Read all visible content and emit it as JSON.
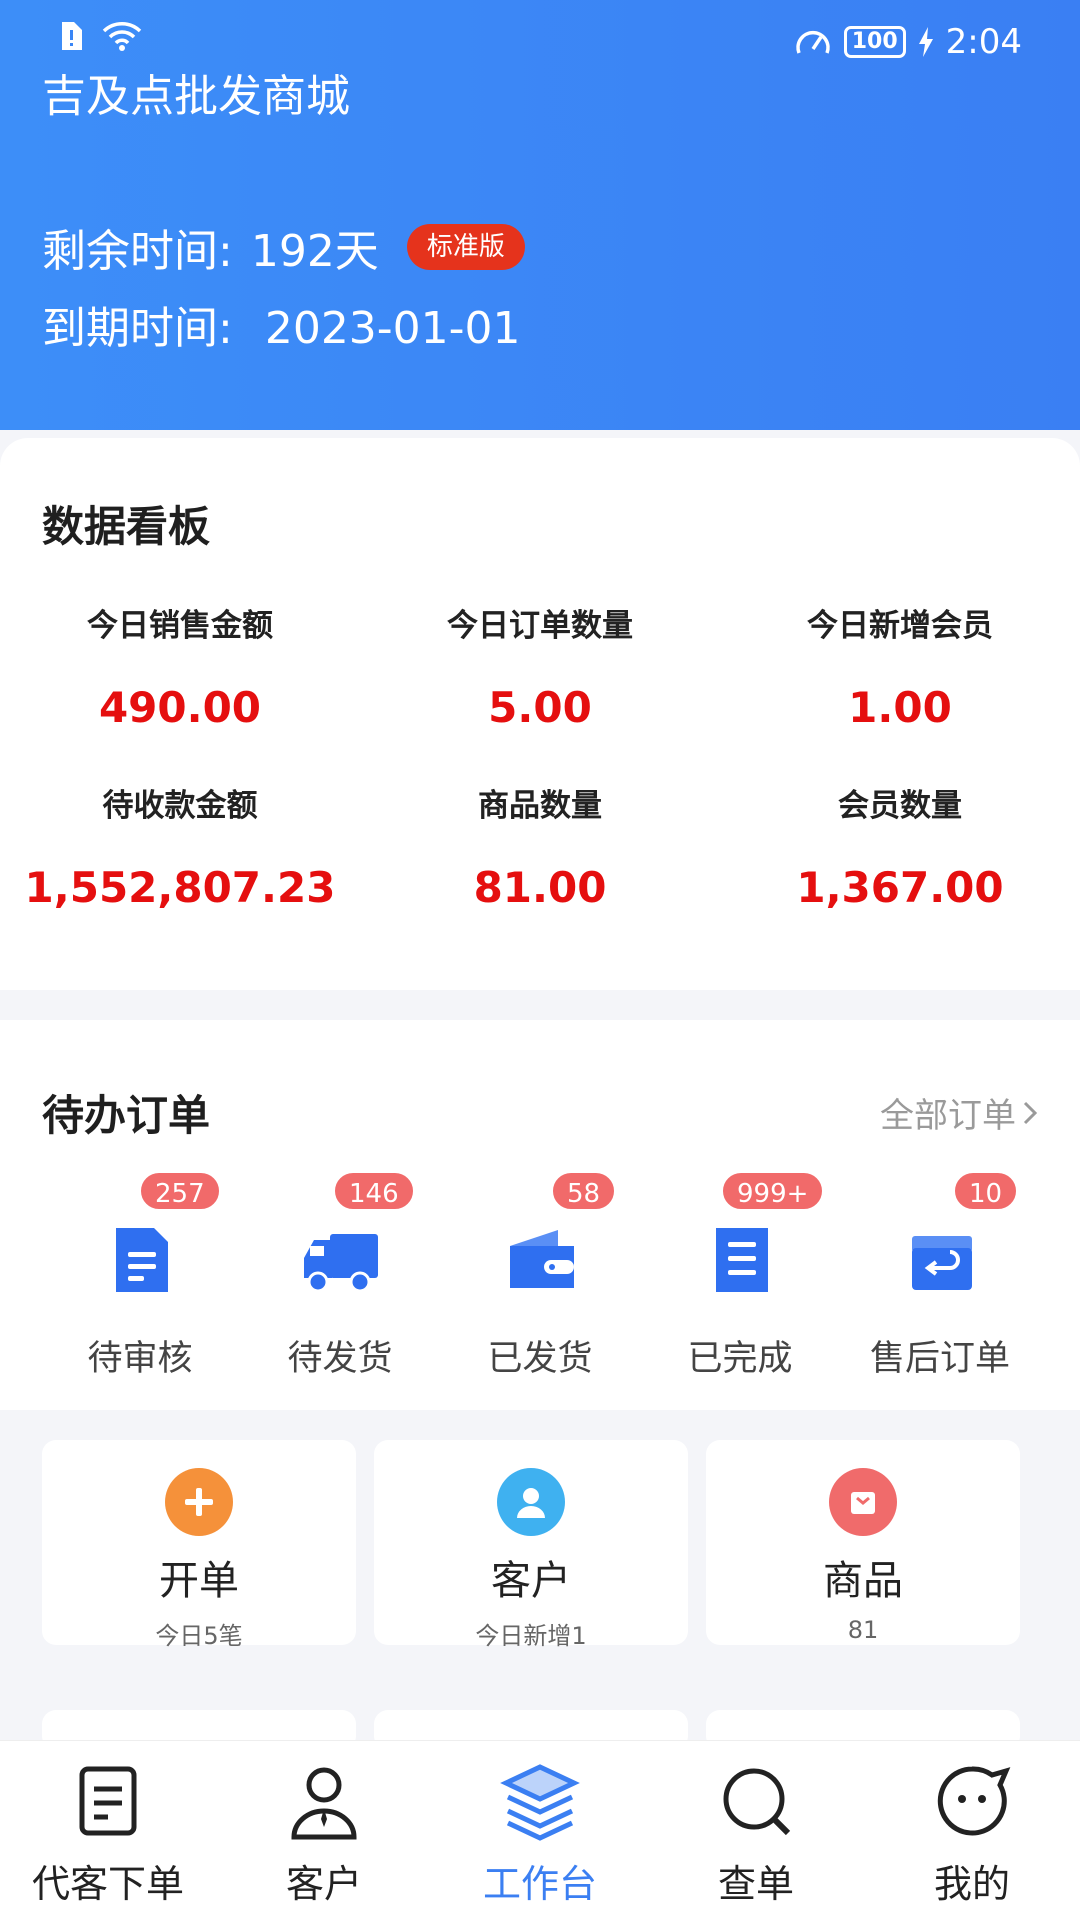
{
  "status_bar": {
    "time": "2:04",
    "battery": "100"
  },
  "header": {
    "title": "吉及点批发商城",
    "remaining_label": "剩余时间:",
    "remaining_value": "192天",
    "edition_badge": "标准版",
    "expire_label": "到期时间:",
    "expire_value": "2023-01-01"
  },
  "board": {
    "title": "数据看板",
    "stats": [
      {
        "label": "今日销售金额",
        "value": "490.00"
      },
      {
        "label": "今日订单数量",
        "value": "5.00"
      },
      {
        "label": "今日新增会员",
        "value": "1.00"
      },
      {
        "label": "待收款金额",
        "value": "1,552,807.23"
      },
      {
        "label": "商品数量",
        "value": "81.00"
      },
      {
        "label": "会员数量",
        "value": "1,367.00"
      }
    ]
  },
  "orders": {
    "title": "待办订单",
    "all_link": "全部订单",
    "items": [
      {
        "label": "待审核",
        "count": "257",
        "icon": "document-icon"
      },
      {
        "label": "待发货",
        "count": "146",
        "icon": "truck-icon"
      },
      {
        "label": "已发货",
        "count": "58",
        "icon": "wallet-icon"
      },
      {
        "label": "已完成",
        "count": "999+",
        "icon": "list-icon"
      },
      {
        "label": "售后订单",
        "count": "10",
        "icon": "return-box-icon"
      }
    ]
  },
  "shortcuts": [
    {
      "name": "开单",
      "sub": "今日5笔",
      "icon": "plus-icon",
      "color": "#f5913a"
    },
    {
      "name": "客户",
      "sub": "今日新增1",
      "icon": "person-icon",
      "color": "#3fb1f0"
    },
    {
      "name": "商品",
      "sub": "81",
      "icon": "bag-icon",
      "color": "#f06b6b"
    }
  ],
  "tabbar": {
    "items": [
      {
        "label": "代客下单",
        "icon": "order-doc-icon"
      },
      {
        "label": "客户",
        "icon": "customer-icon"
      },
      {
        "label": "工作台",
        "icon": "layers-icon",
        "active": true
      },
      {
        "label": "查单",
        "icon": "search-icon"
      },
      {
        "label": "我的",
        "icon": "chat-face-icon"
      }
    ]
  },
  "colors": {
    "header_blue": "#3a86f6",
    "value_red": "#e50f0f",
    "badge_red": "#e5331c",
    "icon_blue": "#2f6ff0",
    "active_tab": "#3b7ff2"
  }
}
